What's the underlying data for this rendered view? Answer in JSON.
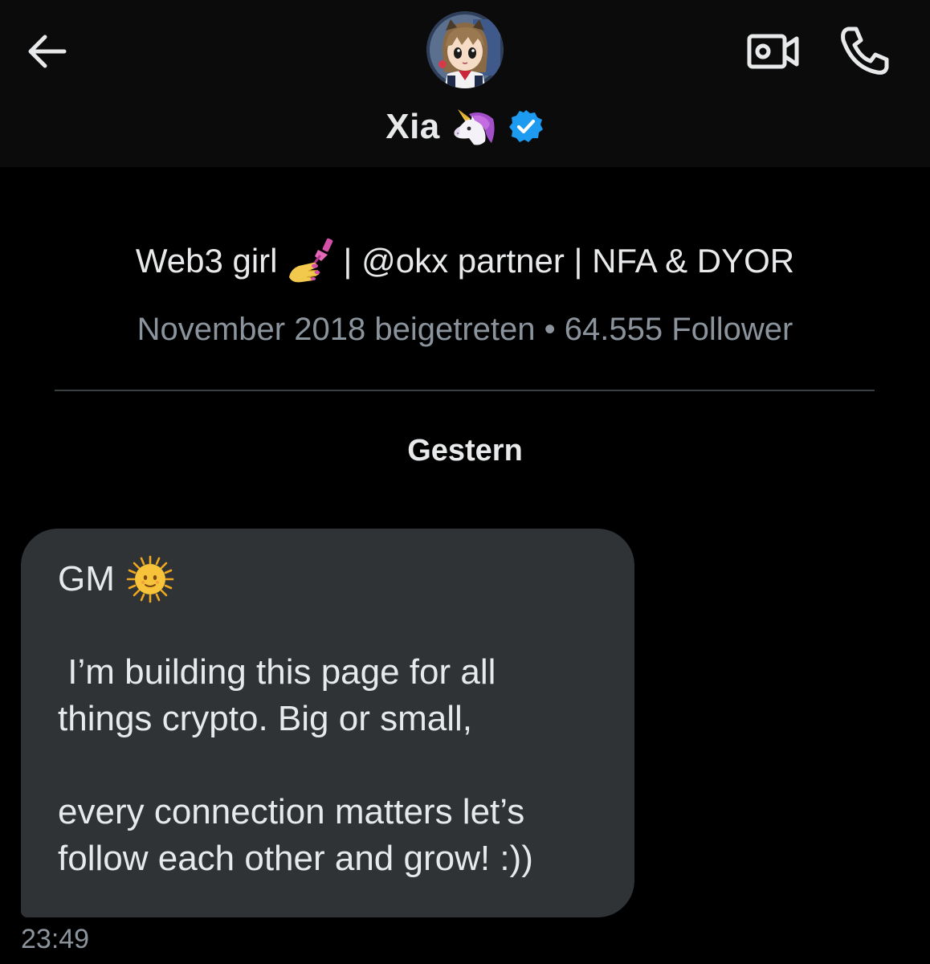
{
  "header": {
    "display_name": "Xia",
    "name_emoji": "unicorn-emoji",
    "verified": true,
    "accent_color": "#1d9bf0",
    "icons": [
      "back-arrow-icon",
      "video-call-icon",
      "phone-icon"
    ]
  },
  "profile": {
    "bio_prefix": "Web3 girl",
    "bio_emoji": "nail-polish-emoji",
    "bio_suffix": "| @okx partner | NFA & DYOR",
    "joined": "November 2018 beigetreten",
    "separator": "•",
    "followers": "64.555 Follower"
  },
  "conversation": {
    "day_label": "Gestern",
    "message": {
      "greeting": "GM",
      "greeting_emoji": "sun-with-face-emoji",
      "line1": " I’m building this page for all",
      "line2": "things crypto. Big or small,",
      "line3": "every connection matters let’s",
      "line4": "follow each other and grow! :))",
      "time": "23:49"
    }
  }
}
